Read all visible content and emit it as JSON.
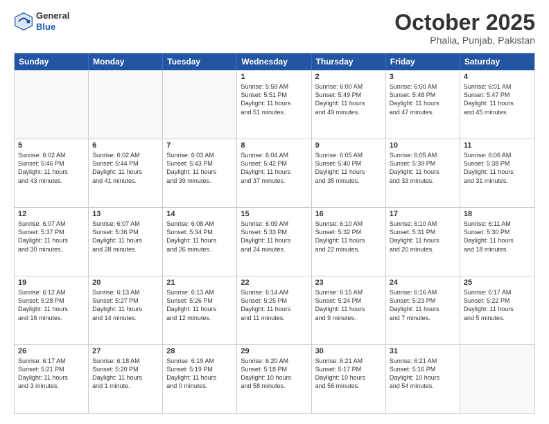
{
  "header": {
    "logo_general": "General",
    "logo_blue": "Blue",
    "month": "October 2025",
    "location": "Phalia, Punjab, Pakistan"
  },
  "weekdays": [
    "Sunday",
    "Monday",
    "Tuesday",
    "Wednesday",
    "Thursday",
    "Friday",
    "Saturday"
  ],
  "rows": [
    [
      {
        "day": "",
        "lines": []
      },
      {
        "day": "",
        "lines": []
      },
      {
        "day": "",
        "lines": []
      },
      {
        "day": "1",
        "lines": [
          "Sunrise: 5:59 AM",
          "Sunset: 5:51 PM",
          "Daylight: 11 hours",
          "and 51 minutes."
        ]
      },
      {
        "day": "2",
        "lines": [
          "Sunrise: 6:00 AM",
          "Sunset: 5:49 PM",
          "Daylight: 11 hours",
          "and 49 minutes."
        ]
      },
      {
        "day": "3",
        "lines": [
          "Sunrise: 6:00 AM",
          "Sunset: 5:48 PM",
          "Daylight: 11 hours",
          "and 47 minutes."
        ]
      },
      {
        "day": "4",
        "lines": [
          "Sunrise: 6:01 AM",
          "Sunset: 5:47 PM",
          "Daylight: 11 hours",
          "and 45 minutes."
        ]
      }
    ],
    [
      {
        "day": "5",
        "lines": [
          "Sunrise: 6:02 AM",
          "Sunset: 5:46 PM",
          "Daylight: 11 hours",
          "and 43 minutes."
        ]
      },
      {
        "day": "6",
        "lines": [
          "Sunrise: 6:02 AM",
          "Sunset: 5:44 PM",
          "Daylight: 11 hours",
          "and 41 minutes."
        ]
      },
      {
        "day": "7",
        "lines": [
          "Sunrise: 6:03 AM",
          "Sunset: 5:43 PM",
          "Daylight: 11 hours",
          "and 39 minutes."
        ]
      },
      {
        "day": "8",
        "lines": [
          "Sunrise: 6:04 AM",
          "Sunset: 5:42 PM",
          "Daylight: 11 hours",
          "and 37 minutes."
        ]
      },
      {
        "day": "9",
        "lines": [
          "Sunrise: 6:05 AM",
          "Sunset: 5:40 PM",
          "Daylight: 11 hours",
          "and 35 minutes."
        ]
      },
      {
        "day": "10",
        "lines": [
          "Sunrise: 6:05 AM",
          "Sunset: 5:39 PM",
          "Daylight: 11 hours",
          "and 33 minutes."
        ]
      },
      {
        "day": "11",
        "lines": [
          "Sunrise: 6:06 AM",
          "Sunset: 5:38 PM",
          "Daylight: 11 hours",
          "and 31 minutes."
        ]
      }
    ],
    [
      {
        "day": "12",
        "lines": [
          "Sunrise: 6:07 AM",
          "Sunset: 5:37 PM",
          "Daylight: 11 hours",
          "and 30 minutes."
        ]
      },
      {
        "day": "13",
        "lines": [
          "Sunrise: 6:07 AM",
          "Sunset: 5:36 PM",
          "Daylight: 11 hours",
          "and 28 minutes."
        ]
      },
      {
        "day": "14",
        "lines": [
          "Sunrise: 6:08 AM",
          "Sunset: 5:34 PM",
          "Daylight: 11 hours",
          "and 26 minutes."
        ]
      },
      {
        "day": "15",
        "lines": [
          "Sunrise: 6:09 AM",
          "Sunset: 5:33 PM",
          "Daylight: 11 hours",
          "and 24 minutes."
        ]
      },
      {
        "day": "16",
        "lines": [
          "Sunrise: 6:10 AM",
          "Sunset: 5:32 PM",
          "Daylight: 11 hours",
          "and 22 minutes."
        ]
      },
      {
        "day": "17",
        "lines": [
          "Sunrise: 6:10 AM",
          "Sunset: 5:31 PM",
          "Daylight: 11 hours",
          "and 20 minutes."
        ]
      },
      {
        "day": "18",
        "lines": [
          "Sunrise: 6:11 AM",
          "Sunset: 5:30 PM",
          "Daylight: 11 hours",
          "and 18 minutes."
        ]
      }
    ],
    [
      {
        "day": "19",
        "lines": [
          "Sunrise: 6:12 AM",
          "Sunset: 5:28 PM",
          "Daylight: 11 hours",
          "and 16 minutes."
        ]
      },
      {
        "day": "20",
        "lines": [
          "Sunrise: 6:13 AM",
          "Sunset: 5:27 PM",
          "Daylight: 11 hours",
          "and 14 minutes."
        ]
      },
      {
        "day": "21",
        "lines": [
          "Sunrise: 6:13 AM",
          "Sunset: 5:26 PM",
          "Daylight: 11 hours",
          "and 12 minutes."
        ]
      },
      {
        "day": "22",
        "lines": [
          "Sunrise: 6:14 AM",
          "Sunset: 5:25 PM",
          "Daylight: 11 hours",
          "and 11 minutes."
        ]
      },
      {
        "day": "23",
        "lines": [
          "Sunrise: 6:15 AM",
          "Sunset: 5:24 PM",
          "Daylight: 11 hours",
          "and 9 minutes."
        ]
      },
      {
        "day": "24",
        "lines": [
          "Sunrise: 6:16 AM",
          "Sunset: 5:23 PM",
          "Daylight: 11 hours",
          "and 7 minutes."
        ]
      },
      {
        "day": "25",
        "lines": [
          "Sunrise: 6:17 AM",
          "Sunset: 5:22 PM",
          "Daylight: 11 hours",
          "and 5 minutes."
        ]
      }
    ],
    [
      {
        "day": "26",
        "lines": [
          "Sunrise: 6:17 AM",
          "Sunset: 5:21 PM",
          "Daylight: 11 hours",
          "and 3 minutes."
        ]
      },
      {
        "day": "27",
        "lines": [
          "Sunrise: 6:18 AM",
          "Sunset: 5:20 PM",
          "Daylight: 11 hours",
          "and 1 minute."
        ]
      },
      {
        "day": "28",
        "lines": [
          "Sunrise: 6:19 AM",
          "Sunset: 5:19 PM",
          "Daylight: 11 hours",
          "and 0 minutes."
        ]
      },
      {
        "day": "29",
        "lines": [
          "Sunrise: 6:20 AM",
          "Sunset: 5:18 PM",
          "Daylight: 10 hours",
          "and 58 minutes."
        ]
      },
      {
        "day": "30",
        "lines": [
          "Sunrise: 6:21 AM",
          "Sunset: 5:17 PM",
          "Daylight: 10 hours",
          "and 56 minutes."
        ]
      },
      {
        "day": "31",
        "lines": [
          "Sunrise: 6:21 AM",
          "Sunset: 5:16 PM",
          "Daylight: 10 hours",
          "and 54 minutes."
        ]
      },
      {
        "day": "",
        "lines": []
      }
    ]
  ]
}
